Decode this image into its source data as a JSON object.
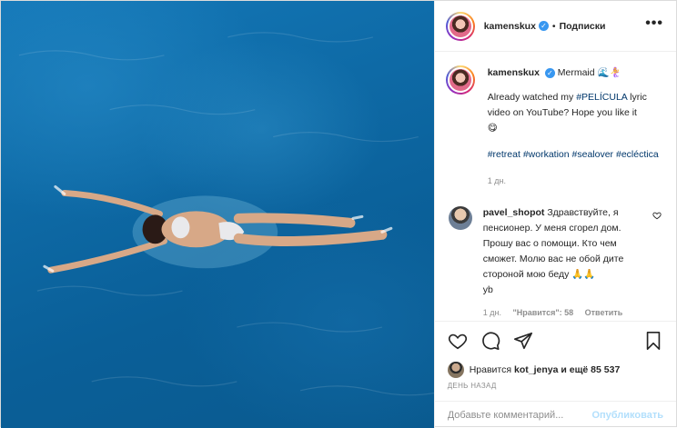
{
  "header": {
    "username": "kamenskux",
    "separator": "•",
    "follow_label": "Подписки",
    "more_label": "•••"
  },
  "caption": {
    "username": "kamenskux",
    "title": "Mermaid",
    "title_emoji": "🌊🧜‍♀️",
    "text_before_link": "Already watched my ",
    "hashtag_link": "#PELÍCULA",
    "text_after_link": " lyric video on YouTube? Hope you like it",
    "text_emoji": "😋",
    "hashtags": [
      "#retreat",
      "#workation",
      "#sealover",
      "#ecléctica"
    ],
    "time": "1 дн."
  },
  "comment": {
    "username": "pavel_shopot",
    "text": "Здравствуйте, я пенсионер. У меня сгорел дом. Прошу вас о помощи. Кто чем сможет. Молю вас не обой дите стороной мою беду",
    "emoji": "🙏🙏",
    "text_tail": "yb",
    "time": "1 дн.",
    "likes": "\"Нравится\": 58",
    "reply_label": "Ответить"
  },
  "likes": {
    "prefix": "Нравится",
    "user": "kot_jenya",
    "suffix": "и ещё 85 537"
  },
  "date_label": "ДЕНЬ НАЗАД",
  "add_comment": {
    "placeholder": "Добавьте комментарий...",
    "publish_label": "Опубликовать"
  },
  "icons": [
    "heart-icon",
    "comment-icon",
    "share-icon",
    "bookmark-icon",
    "more-icon",
    "verified-icon"
  ],
  "colors": {
    "link": "#00376b",
    "verified": "#3897f0",
    "muted": "#8e8e8e",
    "publish": "#b2dffc"
  }
}
